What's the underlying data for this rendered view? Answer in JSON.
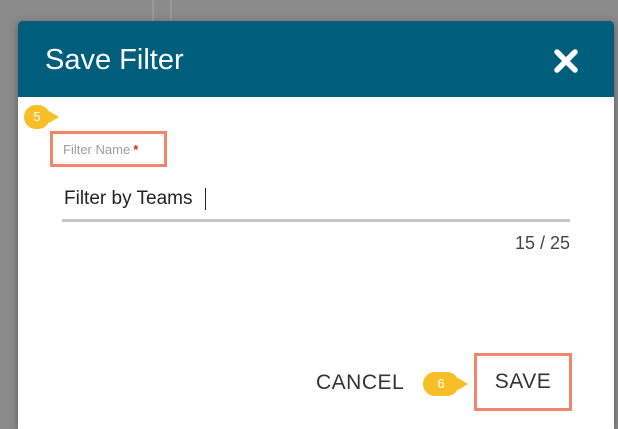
{
  "dialog": {
    "title": "Save Filter",
    "close_icon": "close-icon"
  },
  "steps": {
    "step_5": "5",
    "step_6": "6"
  },
  "field": {
    "label": "Filter Name",
    "required_mark": "*",
    "value": "Filter by Teams",
    "counter": "15 / 25"
  },
  "actions": {
    "cancel_label": "CANCEL",
    "save_label": "SAVE"
  },
  "colors": {
    "header": "#005e7d",
    "highlight": "#f0866a",
    "badge": "#f7bf25"
  }
}
